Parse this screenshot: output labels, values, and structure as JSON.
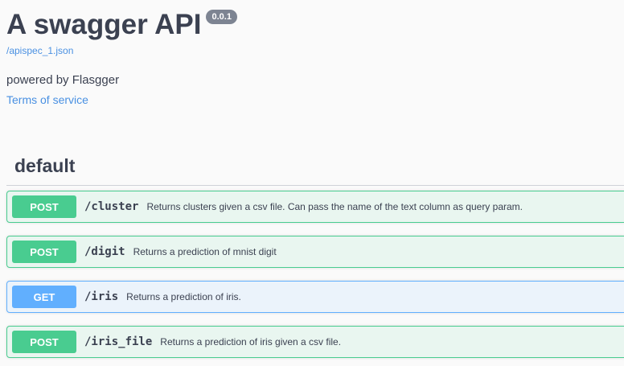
{
  "info": {
    "title": "A swagger API",
    "version": "0.0.1",
    "spec_url": "/apispec_1.json",
    "description": "powered by Flasgger",
    "terms_label": "Terms of service"
  },
  "tag": {
    "name": "default"
  },
  "operations": [
    {
      "method": "POST",
      "path": "/cluster",
      "summary": "Returns clusters given a csv file. Can pass the name of the text column as query param."
    },
    {
      "method": "POST",
      "path": "/digit",
      "summary": "Returns a prediction of mnist digit"
    },
    {
      "method": "GET",
      "path": "/iris",
      "summary": "Returns a prediction of iris."
    },
    {
      "method": "POST",
      "path": "/iris_file",
      "summary": "Returns a prediction of iris given a csv file."
    }
  ],
  "colors": {
    "post": "#49cc90",
    "get": "#61affe",
    "link": "#4990e2",
    "text": "#3b4151"
  }
}
